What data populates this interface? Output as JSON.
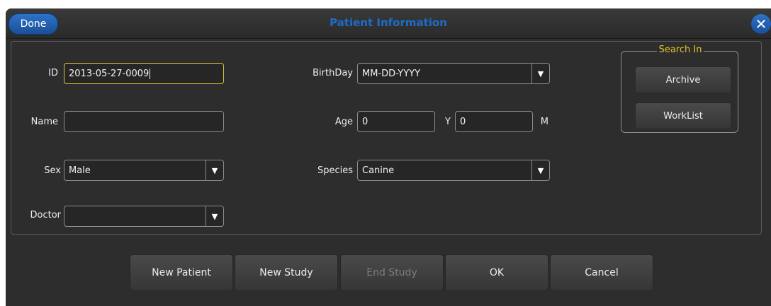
{
  "header": {
    "title": "Patient Information",
    "done_label": "Done",
    "close_icon": "✕"
  },
  "form": {
    "id_label": "ID",
    "id_value": "2013-05-27-0009",
    "name_label": "Name",
    "name_value": "",
    "sex_label": "Sex",
    "sex_value": "Male",
    "doctor_label": "Doctor",
    "doctor_value": "",
    "birthday_label": "BirthDay",
    "birthday_value": "MM-DD-YYYY",
    "age_label": "Age",
    "age_years": "0",
    "age_years_unit": "Y",
    "age_months": "0",
    "age_months_unit": "M",
    "species_label": "Species",
    "species_value": "Canine"
  },
  "search": {
    "title": "Search In",
    "archive_label": "Archive",
    "worklist_label": "WorkList"
  },
  "footer": {
    "new_patient": "New Patient",
    "new_study": "New Study",
    "end_study": "End Study",
    "ok": "OK",
    "cancel": "Cancel"
  },
  "icons": {
    "dropdown_arrow": "▼"
  },
  "colors": {
    "accent": "#1c6ec8",
    "focus_border": "#d8c23c",
    "search_title": "#e3c32a",
    "background": "#2d2d2d"
  }
}
